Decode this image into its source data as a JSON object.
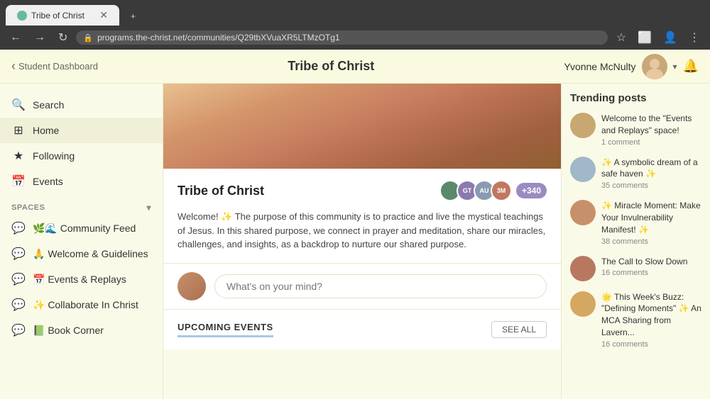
{
  "browser": {
    "tab_title": "Tribe of Christ",
    "url": "programs.the-christ.net/communities/Q29tbXVuaXR5LTMzOTg1",
    "new_tab_label": "+",
    "back_btn": "←",
    "forward_btn": "→",
    "refresh_btn": "↻"
  },
  "top_nav": {
    "back_link": "Student Dashboard",
    "title": "Tribe of Christ",
    "user_name": "Yvonne McNulty",
    "dropdown_label": "▾"
  },
  "sidebar": {
    "search_label": "Search",
    "home_label": "Home",
    "following_label": "Following",
    "events_label": "Events",
    "spaces_section": "SPACES",
    "spaces": [
      {
        "label": "🗨 🌿🌊 Community Feed",
        "icon": "💬"
      },
      {
        "label": "🙏 Welcome & Guidelines",
        "icon": "💬"
      },
      {
        "label": "📅 Events & Replays",
        "icon": "💬"
      },
      {
        "label": "✨ Collaborate In Christ",
        "icon": "💬"
      },
      {
        "label": "📗 Book Corner",
        "icon": "💬"
      }
    ]
  },
  "community": {
    "name": "Tribe of Christ",
    "member_count": "+340",
    "description": "Welcome! ✨ The purpose of this community is to practice and live the mystical teachings of Jesus. In this shared purpose, we connect in prayer and meditation, share our miracles, challenges, and insights, as a backdrop to nurture our shared purpose."
  },
  "post_box": {
    "placeholder": "What's on your mind?"
  },
  "upcoming_events": {
    "title": "UPCOMING EVENTS",
    "see_all": "SEE ALL"
  },
  "trending": {
    "title": "Trending posts",
    "posts": [
      {
        "title": "Welcome to the \"Events and Replays\" space!",
        "comments": "1 comment",
        "avatar_color": "#c8a870"
      },
      {
        "title": "✨ A symbolic dream of a safe haven ✨",
        "comments": "35 comments",
        "avatar_color": "#a0b8c8"
      },
      {
        "title": "✨ Miracle Moment: Make Your Invulnerability Manifest! ✨",
        "comments": "38 comments",
        "avatar_color": "#c8906a"
      },
      {
        "title": "The Call to Slow Down",
        "comments": "16 comments",
        "avatar_color": "#b87860"
      },
      {
        "title": "🌟 This Week's Buzz: \"Defining Moments\" ✨ An MCA Sharing from Lavern...",
        "comments": "16 comments",
        "avatar_color": "#d4a860"
      }
    ]
  }
}
